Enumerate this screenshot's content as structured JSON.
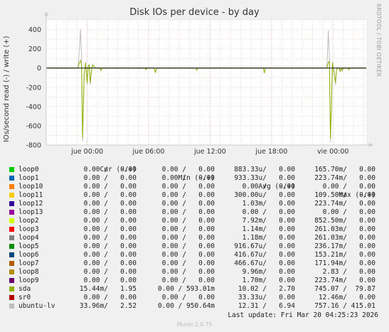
{
  "title": "Disk IOs per device - by day",
  "side_label": "RRDTOOL / TOBI OETIKER",
  "ylabel": "IOs/second read (-) / write (+)",
  "footer": {
    "last_update": "Last update: Fri Mar 20 04:25:23 2026",
    "munin": "Munin 2.0.75"
  },
  "legend": {
    "headers": {
      "cur": "Cur (-/+)",
      "min": "Min (-/+)",
      "avg": "Avg (-/+)",
      "max": "Max (-/+)"
    },
    "rows": [
      {
        "name": "loop0",
        "color": "#00cc00",
        "cur": "0.00 /   0.00",
        "min": "0.00 /   0.00",
        "avg": "883.33u/   0.00",
        "max": "165.70m/   0.00"
      },
      {
        "name": "loop1",
        "color": "#0066b3",
        "cur": "0.00 /   0.00",
        "min": "0.00 /   0.00",
        "avg": "933.33u/   0.00",
        "max": "223.74m/   0.00"
      },
      {
        "name": "loop10",
        "color": "#ff8000",
        "cur": "0.00 /   0.00",
        "min": "0.00 /   0.00",
        "avg": "0.00 /   0.00",
        "max": "0.00 /   0.00"
      },
      {
        "name": "loop11",
        "color": "#ffcc00",
        "cur": "0.00 /   0.00",
        "min": "0.00 /   0.00",
        "avg": "300.00u/   0.00",
        "max": "109.50m/   0.00"
      },
      {
        "name": "loop12",
        "color": "#330099",
        "cur": "0.00 /   0.00",
        "min": "0.00 /   0.00",
        "avg": "1.03m/   0.00",
        "max": "223.74m/   0.00"
      },
      {
        "name": "loop13",
        "color": "#990099",
        "cur": "0.00 /   0.00",
        "min": "0.00 /   0.00",
        "avg": "0.00 /   0.00",
        "max": "0.00 /   0.00"
      },
      {
        "name": "loop2",
        "color": "#ccff00",
        "cur": "0.00 /   0.00",
        "min": "0.00 /   0.00",
        "avg": "7.92m/   0.00",
        "max": "852.50m/   0.00"
      },
      {
        "name": "loop3",
        "color": "#ff0000",
        "cur": "0.00 /   0.00",
        "min": "0.00 /   0.00",
        "avg": "1.14m/   0.00",
        "max": "261.03m/   0.00"
      },
      {
        "name": "loop4",
        "color": "#808080",
        "cur": "0.00 /   0.00",
        "min": "0.00 /   0.00",
        "avg": "1.18m/   0.00",
        "max": "261.03m/   0.00"
      },
      {
        "name": "loop5",
        "color": "#008f00",
        "cur": "0.00 /   0.00",
        "min": "0.00 /   0.00",
        "avg": "916.67u/   0.00",
        "max": "236.17m/   0.00"
      },
      {
        "name": "loop6",
        "color": "#00487d",
        "cur": "0.00 /   0.00",
        "min": "0.00 /   0.00",
        "avg": "416.67u/   0.00",
        "max": "153.21m/   0.00"
      },
      {
        "name": "loop7",
        "color": "#b35a00",
        "cur": "0.00 /   0.00",
        "min": "0.00 /   0.00",
        "avg": "466.67u/   0.00",
        "max": "171.94m/   0.00"
      },
      {
        "name": "loop8",
        "color": "#b38f00",
        "cur": "0.00 /   0.00",
        "min": "0.00 /   0.00",
        "avg": "9.96m/   0.00",
        "max": "2.83 /   0.00"
      },
      {
        "name": "loop9",
        "color": "#6b006b",
        "cur": "0.00 /   0.00",
        "min": "0.00 /   0.00",
        "avg": "1.70m/   0.00",
        "max": "223.74m/   0.00"
      },
      {
        "name": "sda",
        "color": "#8fb300",
        "cur": "15.44m/   1.95",
        "min": "0.00 / 593.01m",
        "avg": "10.02 /   2.70",
        "max": "745.07 /  79.87"
      },
      {
        "name": "sr0",
        "color": "#b30000",
        "cur": "0.00 /   0.00",
        "min": "0.00 /   0.00",
        "avg": "33.33u/   0.00",
        "max": "12.46m/   0.00"
      },
      {
        "name": "ubuntu-lv",
        "color": "#bebebe",
        "cur": "33.96m/   2.52",
        "min": "0.00 / 950.64m",
        "avg": "12.31 /   6.94",
        "max": "757.16 / 415.01"
      }
    ]
  },
  "chart_data": {
    "type": "line",
    "title": "Disk IOs per device - by day",
    "ylabel": "IOs/second read (-) / write (+)",
    "ylim": [
      -800,
      500
    ],
    "yticks": [
      400,
      200,
      0,
      -200,
      -400,
      -600,
      -800
    ],
    "xlim": [
      0,
      31.25
    ],
    "xticks": [
      {
        "t": 4,
        "label": "jue 00:00"
      },
      {
        "t": 10,
        "label": "jue 06:00"
      },
      {
        "t": 16,
        "label": "jue 12:00"
      },
      {
        "t": 22,
        "label": "jue 18:00"
      },
      {
        "t": 28,
        "label": "vie 00:00"
      }
    ],
    "grid": true,
    "colors": {
      "background": "#ffffff",
      "grid": "#e8b5b5",
      "zero_line": "#000000",
      "axis": "#cccccc"
    },
    "series": [
      {
        "name": "ubuntu-lv",
        "color": "#bebebe",
        "points": [
          [
            0,
            0
          ],
          [
            3.1,
            0
          ],
          [
            3.25,
            200
          ],
          [
            3.35,
            400
          ],
          [
            3.45,
            120
          ],
          [
            3.55,
            -760
          ],
          [
            3.7,
            -80
          ],
          [
            3.85,
            60
          ],
          [
            4.0,
            -170
          ],
          [
            4.1,
            20
          ],
          [
            4.2,
            40
          ],
          [
            4.3,
            -170
          ],
          [
            4.45,
            0
          ],
          [
            4.55,
            40
          ],
          [
            4.7,
            10
          ],
          [
            4.85,
            0
          ],
          [
            5.25,
            0
          ],
          [
            5.35,
            -30
          ],
          [
            5.45,
            0
          ],
          [
            9.65,
            0
          ],
          [
            9.75,
            -20
          ],
          [
            9.85,
            0
          ],
          [
            10.55,
            0
          ],
          [
            10.65,
            -50
          ],
          [
            10.75,
            -20
          ],
          [
            10.85,
            0
          ],
          [
            14.6,
            0
          ],
          [
            14.7,
            -25
          ],
          [
            14.8,
            0
          ],
          [
            21.2,
            0
          ],
          [
            21.3,
            -55
          ],
          [
            21.4,
            0
          ],
          [
            27.4,
            0
          ],
          [
            27.55,
            390
          ],
          [
            27.65,
            100
          ],
          [
            27.75,
            -770
          ],
          [
            27.85,
            -420
          ],
          [
            27.95,
            60
          ],
          [
            28.05,
            0
          ],
          [
            28.15,
            -90
          ],
          [
            28.25,
            -170
          ],
          [
            28.35,
            -20
          ],
          [
            28.45,
            0
          ],
          [
            28.6,
            0
          ],
          [
            28.7,
            -40
          ],
          [
            28.8,
            0
          ],
          [
            28.9,
            -30
          ],
          [
            29.0,
            0
          ],
          [
            29.45,
            0
          ],
          [
            29.55,
            -20
          ],
          [
            29.65,
            0
          ],
          [
            31.25,
            0
          ]
        ]
      },
      {
        "name": "sda",
        "color": "#8fb300",
        "points": [
          [
            0,
            0
          ],
          [
            3.1,
            0
          ],
          [
            3.25,
            60
          ],
          [
            3.35,
            80
          ],
          [
            3.45,
            30
          ],
          [
            3.55,
            -720
          ],
          [
            3.7,
            -70
          ],
          [
            3.85,
            50
          ],
          [
            4.0,
            -150
          ],
          [
            4.1,
            20
          ],
          [
            4.2,
            30
          ],
          [
            4.3,
            -150
          ],
          [
            4.45,
            0
          ],
          [
            4.55,
            30
          ],
          [
            4.7,
            10
          ],
          [
            4.85,
            0
          ],
          [
            5.25,
            0
          ],
          [
            5.35,
            -25
          ],
          [
            5.45,
            0
          ],
          [
            9.65,
            0
          ],
          [
            9.75,
            -15
          ],
          [
            9.85,
            0
          ],
          [
            10.55,
            0
          ],
          [
            10.65,
            -45
          ],
          [
            10.75,
            -15
          ],
          [
            10.85,
            0
          ],
          [
            14.6,
            0
          ],
          [
            14.7,
            -20
          ],
          [
            14.8,
            0
          ],
          [
            21.2,
            0
          ],
          [
            21.3,
            -50
          ],
          [
            21.4,
            0
          ],
          [
            27.4,
            0
          ],
          [
            27.55,
            60
          ],
          [
            27.65,
            70
          ],
          [
            27.75,
            -730
          ],
          [
            27.85,
            -400
          ],
          [
            27.95,
            50
          ],
          [
            28.05,
            0
          ],
          [
            28.15,
            -80
          ],
          [
            28.25,
            -150
          ],
          [
            28.35,
            -15
          ],
          [
            28.45,
            0
          ],
          [
            28.6,
            0
          ],
          [
            28.7,
            -35
          ],
          [
            28.8,
            0
          ],
          [
            28.9,
            -25
          ],
          [
            29.0,
            0
          ],
          [
            29.45,
            0
          ],
          [
            29.55,
            -15
          ],
          [
            29.65,
            0
          ],
          [
            31.25,
            0
          ]
        ]
      }
    ]
  }
}
